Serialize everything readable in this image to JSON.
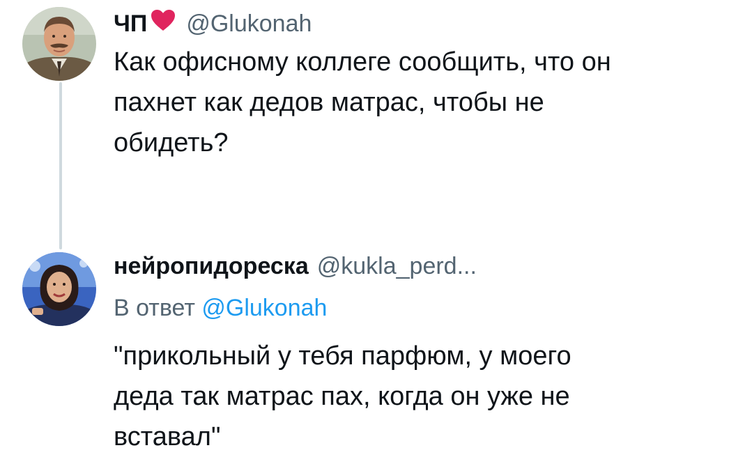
{
  "tweet1": {
    "display_name": "ЧП",
    "name_emoji": "heart",
    "handle": "@Glukonah",
    "text": "Как офисному коллеге сообщить, что он\nпахнет как дедов матрас, чтобы не\nобидеть?"
  },
  "tweet2": {
    "display_name": "нейропидореска",
    "handle": "@kukla_perd...",
    "reply_prefix": "В ответ",
    "reply_handle": "@Glukonah",
    "text": "\"прикольный у тебя парфюм, у моего\nдеда так матрас пах, когда он уже не\nвставал\""
  },
  "colors": {
    "text": "#0f1419",
    "secondary": "#536471",
    "link": "#1d9bf0",
    "heart": "#e0245e",
    "thread_line": "#cfd9de"
  }
}
